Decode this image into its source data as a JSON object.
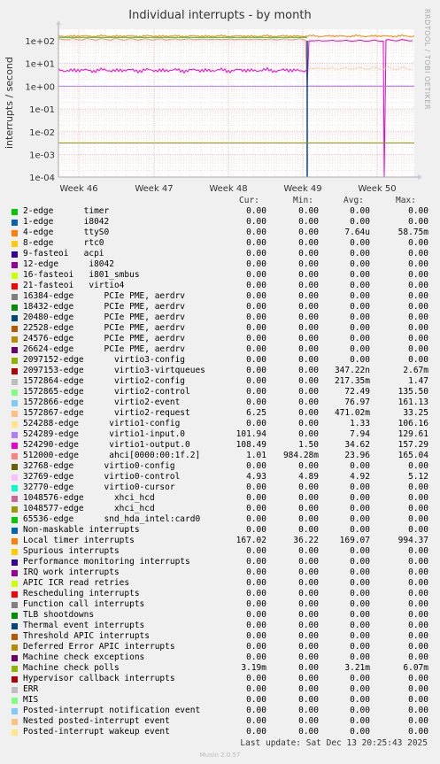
{
  "title": "Individual interrupts - by month",
  "side_label": "RRDTOOL / TOBI OETIKER",
  "footer": "Munin 2.0.57",
  "last_update": "Last update: Sat Dec 13 20:25:43 2025",
  "legend_headers": {
    "cur": "Cur:",
    "min": "Min:",
    "avg": "Avg:",
    "max": "Max:"
  },
  "chart_data": {
    "type": "line",
    "title": "Individual interrupts - by month",
    "ylabel": "interrupts / second",
    "xlabel": "",
    "y_scale": "log",
    "ylim": [
      0.0001,
      300
    ],
    "y_ticks": [
      "1e+02",
      "1e+01",
      "1e+00",
      "1e-01",
      "1e-02",
      "1e-03",
      "1e-04"
    ],
    "x_ticks": [
      "Week 46",
      "Week 47",
      "Week 48",
      "Week 49",
      "Week 50"
    ],
    "grid": true,
    "series": [
      {
        "name": "2-edge      timer",
        "color": "#00cc00",
        "cur": "0.00",
        "min": "0.00",
        "avg": "0.00",
        "max": "0.00"
      },
      {
        "name": "1-edge      i8042",
        "color": "#0066b3",
        "cur": "0.00",
        "min": "0.00",
        "avg": "0.00",
        "max": "0.00"
      },
      {
        "name": "4-edge      ttyS0",
        "color": "#ff8000",
        "cur": "0.00",
        "min": "0.00",
        "avg": "7.64u",
        "max": "58.75m"
      },
      {
        "name": "8-edge      rtc0",
        "color": "#ffcc00",
        "cur": "0.00",
        "min": "0.00",
        "avg": "0.00",
        "max": "0.00"
      },
      {
        "name": "9-fasteoi   acpi",
        "color": "#330099",
        "cur": "0.00",
        "min": "0.00",
        "avg": "0.00",
        "max": "0.00"
      },
      {
        "name": "12-edge      i8042",
        "color": "#990099",
        "cur": "0.00",
        "min": "0.00",
        "avg": "0.00",
        "max": "0.00"
      },
      {
        "name": "16-fasteoi   i801_smbus",
        "color": "#ccff00",
        "cur": "0.00",
        "min": "0.00",
        "avg": "0.00",
        "max": "0.00"
      },
      {
        "name": "21-fasteoi   virtio4",
        "color": "#ff0000",
        "cur": "0.00",
        "min": "0.00",
        "avg": "0.00",
        "max": "0.00"
      },
      {
        "name": "16384-edge      PCIe PME, aerdrv",
        "color": "#808080",
        "cur": "0.00",
        "min": "0.00",
        "avg": "0.00",
        "max": "0.00"
      },
      {
        "name": "18432-edge      PCIe PME, aerdrv",
        "color": "#008f00",
        "cur": "0.00",
        "min": "0.00",
        "avg": "0.00",
        "max": "0.00"
      },
      {
        "name": "20480-edge      PCIe PME, aerdrv",
        "color": "#00487d",
        "cur": "0.00",
        "min": "0.00",
        "avg": "0.00",
        "max": "0.00"
      },
      {
        "name": "22528-edge      PCIe PME, aerdrv",
        "color": "#b35a00",
        "cur": "0.00",
        "min": "0.00",
        "avg": "0.00",
        "max": "0.00"
      },
      {
        "name": "24576-edge      PCIe PME, aerdrv",
        "color": "#b38f00",
        "cur": "0.00",
        "min": "0.00",
        "avg": "0.00",
        "max": "0.00"
      },
      {
        "name": "26624-edge      PCIe PME, aerdrv",
        "color": "#6b006b",
        "cur": "0.00",
        "min": "0.00",
        "avg": "0.00",
        "max": "0.00"
      },
      {
        "name": "2097152-edge      virtio3-config",
        "color": "#8fb300",
        "cur": "0.00",
        "min": "0.00",
        "avg": "0.00",
        "max": "0.00"
      },
      {
        "name": "2097153-edge      virtio3-virtqueues",
        "color": "#b30000",
        "cur": "0.00",
        "min": "0.00",
        "avg": "347.22n",
        "max": "2.67m"
      },
      {
        "name": "1572864-edge      virtio2-config",
        "color": "#bebebe",
        "cur": "0.00",
        "min": "0.00",
        "avg": "217.35m",
        "max": "1.47"
      },
      {
        "name": "1572865-edge      virtio2-control",
        "color": "#80ff80",
        "cur": "0.00",
        "min": "0.00",
        "avg": "72.49",
        "max": "135.50"
      },
      {
        "name": "1572866-edge      virtio2-event",
        "color": "#80c9ff",
        "cur": "0.00",
        "min": "0.00",
        "avg": "76.97",
        "max": "161.13"
      },
      {
        "name": "1572867-edge      virtio2-request",
        "color": "#ffc080",
        "cur": "6.25",
        "min": "0.00",
        "avg": "471.02m",
        "max": "33.25"
      },
      {
        "name": "524288-edge      virtio1-config",
        "color": "#ffe680",
        "cur": "0.00",
        "min": "0.00",
        "avg": "1.33",
        "max": "106.16"
      },
      {
        "name": "524289-edge      virtio1-input.0",
        "color": "#aa80ff",
        "cur": "101.94",
        "min": "0.00",
        "avg": "7.94",
        "max": "129.61"
      },
      {
        "name": "524290-edge      virtio1-output.0",
        "color": "#ee00cc",
        "cur": "108.49",
        "min": "1.50",
        "avg": "34.62",
        "max": "157.29"
      },
      {
        "name": "512000-edge      ahci[0000:00:1f.2]",
        "color": "#ff8080",
        "cur": "1.01",
        "min": "984.28m",
        "avg": "23.96",
        "max": "165.04"
      },
      {
        "name": "32768-edge      virtio0-config",
        "color": "#666600",
        "cur": "0.00",
        "min": "0.00",
        "avg": "0.00",
        "max": "0.00"
      },
      {
        "name": "32769-edge      virtio0-control",
        "color": "#ffbfff",
        "cur": "4.93",
        "min": "4.89",
        "avg": "4.92",
        "max": "5.12"
      },
      {
        "name": "32770-edge      virtio0-cursor",
        "color": "#00ffcc",
        "cur": "0.00",
        "min": "0.00",
        "avg": "0.00",
        "max": "0.00"
      },
      {
        "name": "1048576-edge      xhci_hcd",
        "color": "#cc6699",
        "cur": "0.00",
        "min": "0.00",
        "avg": "0.00",
        "max": "0.00"
      },
      {
        "name": "1048577-edge      xhci_hcd",
        "color": "#999900",
        "cur": "0.00",
        "min": "0.00",
        "avg": "0.00",
        "max": "0.00"
      },
      {
        "name": "65536-edge      snd_hda_intel:card0",
        "color": "#00cc00",
        "cur": "0.00",
        "min": "0.00",
        "avg": "0.00",
        "max": "0.00"
      },
      {
        "name": "Non-maskable interrupts",
        "color": "#0066b3",
        "cur": "0.00",
        "min": "0.00",
        "avg": "0.00",
        "max": "0.00"
      },
      {
        "name": "Local timer interrupts",
        "color": "#ff8000",
        "cur": "167.02",
        "min": "36.22",
        "avg": "169.07",
        "max": "994.37"
      },
      {
        "name": "Spurious interrupts",
        "color": "#ffcc00",
        "cur": "0.00",
        "min": "0.00",
        "avg": "0.00",
        "max": "0.00"
      },
      {
        "name": "Performance monitoring interrupts",
        "color": "#330099",
        "cur": "0.00",
        "min": "0.00",
        "avg": "0.00",
        "max": "0.00"
      },
      {
        "name": "IRQ work interrupts",
        "color": "#990099",
        "cur": "0.00",
        "min": "0.00",
        "avg": "0.00",
        "max": "0.00"
      },
      {
        "name": "APIC ICR read retries",
        "color": "#ccff00",
        "cur": "0.00",
        "min": "0.00",
        "avg": "0.00",
        "max": "0.00"
      },
      {
        "name": "Rescheduling interrupts",
        "color": "#ff0000",
        "cur": "0.00",
        "min": "0.00",
        "avg": "0.00",
        "max": "0.00"
      },
      {
        "name": "Function call interrupts",
        "color": "#808080",
        "cur": "0.00",
        "min": "0.00",
        "avg": "0.00",
        "max": "0.00"
      },
      {
        "name": "TLB shootdowns",
        "color": "#008f00",
        "cur": "0.00",
        "min": "0.00",
        "avg": "0.00",
        "max": "0.00"
      },
      {
        "name": "Thermal event interrupts",
        "color": "#00487d",
        "cur": "0.00",
        "min": "0.00",
        "avg": "0.00",
        "max": "0.00"
      },
      {
        "name": "Threshold APIC interrupts",
        "color": "#b35a00",
        "cur": "0.00",
        "min": "0.00",
        "avg": "0.00",
        "max": "0.00"
      },
      {
        "name": "Deferred Error APIC interrupts",
        "color": "#b38f00",
        "cur": "0.00",
        "min": "0.00",
        "avg": "0.00",
        "max": "0.00"
      },
      {
        "name": "Machine check exceptions",
        "color": "#6b006b",
        "cur": "0.00",
        "min": "0.00",
        "avg": "0.00",
        "max": "0.00"
      },
      {
        "name": "Machine check polls",
        "color": "#8fb300",
        "cur": "3.19m",
        "min": "0.00",
        "avg": "3.21m",
        "max": "6.07m"
      },
      {
        "name": "Hypervisor callback interrupts",
        "color": "#b30000",
        "cur": "0.00",
        "min": "0.00",
        "avg": "0.00",
        "max": "0.00"
      },
      {
        "name": "ERR",
        "color": "#bebebe",
        "cur": "0.00",
        "min": "0.00",
        "avg": "0.00",
        "max": "0.00"
      },
      {
        "name": "MIS",
        "color": "#80ff80",
        "cur": "0.00",
        "min": "0.00",
        "avg": "0.00",
        "max": "0.00"
      },
      {
        "name": "Posted-interrupt notification event",
        "color": "#80c9ff",
        "cur": "0.00",
        "min": "0.00",
        "avg": "0.00",
        "max": "0.00"
      },
      {
        "name": "Nested posted-interrupt event",
        "color": "#ffc080",
        "cur": "0.00",
        "min": "0.00",
        "avg": "0.00",
        "max": "0.00"
      },
      {
        "name": "Posted-interrupt wakeup event",
        "color": "#ffe680",
        "cur": "0.00",
        "min": "0.00",
        "avg": "0.00",
        "max": "0.00"
      }
    ]
  }
}
